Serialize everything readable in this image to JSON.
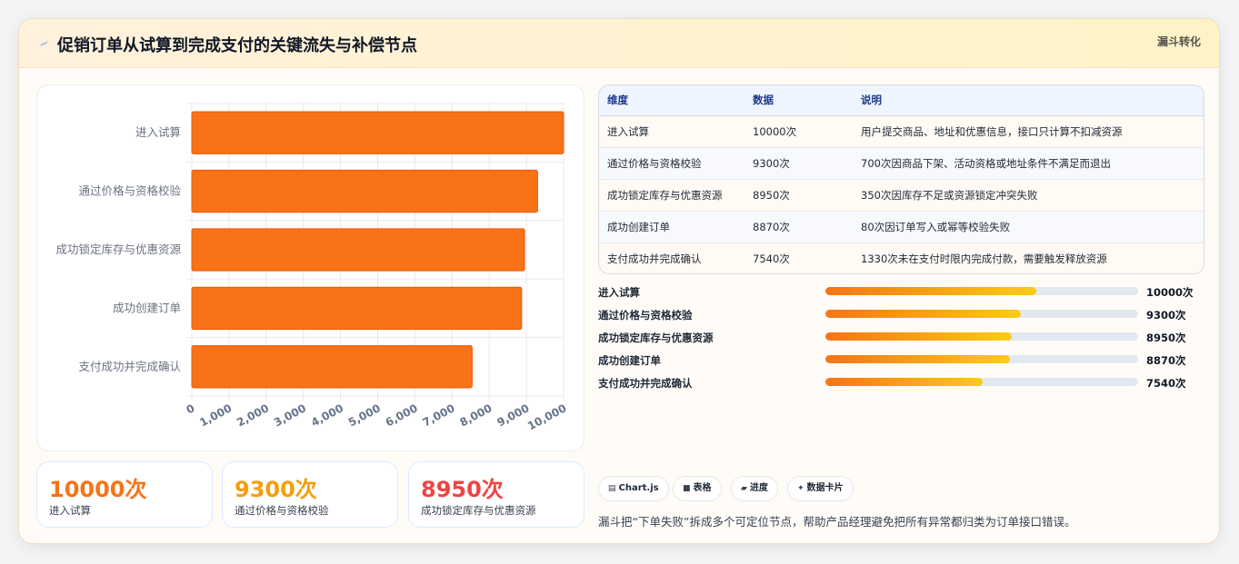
{
  "header": {
    "title": "促销订单从试算到完成支付的关键流失与补偿节点",
    "tag": "漏斗转化",
    "icon": "lightning-icon"
  },
  "chart_data": {
    "type": "bar",
    "orientation": "horizontal",
    "categories": [
      "进入试算",
      "通过价格与资格校验",
      "成功锁定库存与优惠资源",
      "成功创建订单",
      "支付成功并完成确认"
    ],
    "values": [
      10000,
      9300,
      8950,
      8870,
      7540
    ],
    "xlim": [
      0,
      10000
    ],
    "x_ticks": [
      "0",
      "1,000",
      "2,000",
      "3,000",
      "4,000",
      "5,000",
      "6,000",
      "7,000",
      "8,000",
      "9,000",
      "10,000"
    ],
    "grid": true,
    "bar_color": "#f97316"
  },
  "stats": [
    {
      "value": "10000次",
      "label": "进入试算",
      "color": "#f97316"
    },
    {
      "value": "9300次",
      "label": "通过价格与资格校验",
      "color": "#f59e0b"
    },
    {
      "value": "8950次",
      "label": "成功锁定库存与优惠资源",
      "color": "#ef4444"
    }
  ],
  "table": {
    "headers": [
      "维度",
      "数据",
      "说明"
    ],
    "rows": [
      [
        "进入试算",
        "10000次",
        "用户提交商品、地址和优惠信息，接口只计算不扣减资源"
      ],
      [
        "通过价格与资格校验",
        "9300次",
        "700次因商品下架、活动资格或地址条件不满足而退出"
      ],
      [
        "成功锁定库存与优惠资源",
        "8950次",
        "350次因库存不足或资源锁定冲突失败"
      ],
      [
        "成功创建订单",
        "8870次",
        "80次因订单写入或幂等校验失败"
      ],
      [
        "支付成功并完成确认",
        "7540次",
        "1330次未在支付时限内完成付款，需要触发释放资源"
      ]
    ]
  },
  "progress": [
    {
      "label": "进入试算",
      "count": "10000次",
      "fraction": 0.673
    },
    {
      "label": "通过价格与资格校验",
      "count": "9300次",
      "fraction": 0.625
    },
    {
      "label": "成功锁定库存与优惠资源",
      "count": "8950次",
      "fraction": 0.597
    },
    {
      "label": "成功创建订单",
      "count": "8870次",
      "fraction": 0.59
    },
    {
      "label": "支付成功并完成确认",
      "count": "7540次",
      "fraction": 0.503
    }
  ],
  "chips": [
    {
      "icon": "▤",
      "label": "Chart.js"
    },
    {
      "icon": "■",
      "label": "表格"
    },
    {
      "icon": "▰",
      "label": "进度"
    },
    {
      "icon": "✦",
      "label": "数据卡片"
    }
  ],
  "note": "漏斗把“下单失败”拆成多个可定位节点，帮助产品经理避免把所有异常都归类为订单接口错误。"
}
